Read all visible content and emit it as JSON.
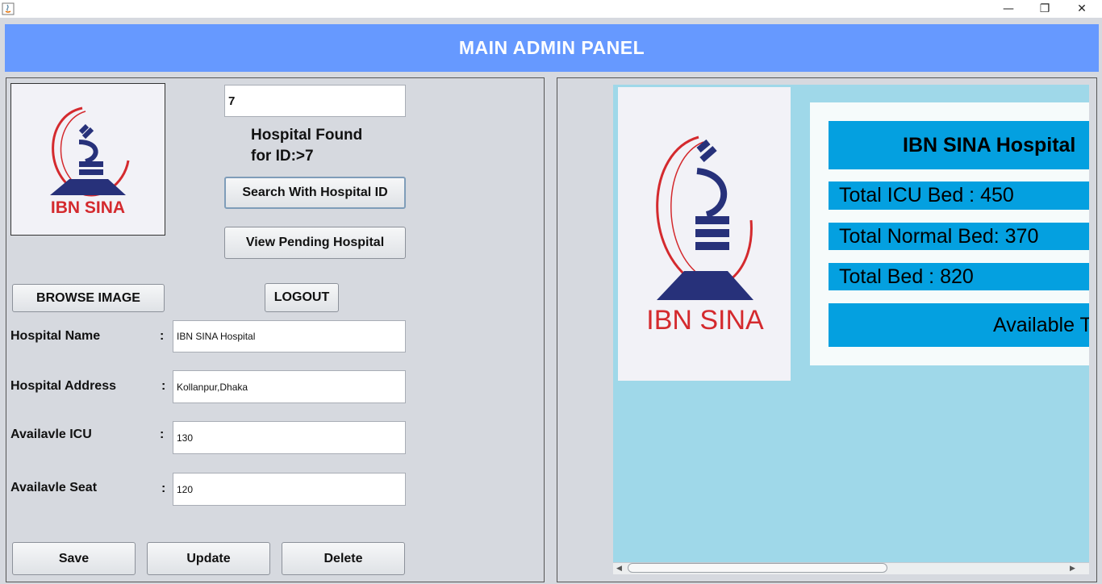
{
  "window": {
    "minimize_glyph": "—",
    "restore_glyph": "❐",
    "close_glyph": "✕"
  },
  "header": {
    "title": "MAIN ADMIN PANEL"
  },
  "search": {
    "id_value": "7",
    "status_line1": "Hospital Found",
    "status_line2": "for ID:>7",
    "search_button": "Search With Hospital ID",
    "pending_button": "View Pending Hospital"
  },
  "actions": {
    "browse_image": "BROWSE IMAGE",
    "logout": "LOGOUT",
    "save": "Save",
    "update": "Update",
    "delete": "Delete"
  },
  "form": {
    "colon": ":",
    "fields": [
      {
        "label": "Hospital Name",
        "value": "IBN SINA Hospital"
      },
      {
        "label": "Hospital Address",
        "value": "Kollanpur,Dhaka"
      },
      {
        "label": "Availavle ICU",
        "value": "130"
      },
      {
        "label": "Availavle Seat",
        "value": "120"
      }
    ]
  },
  "logo": {
    "text": "IBN SINA",
    "brand_red": "#d42a2e",
    "brand_blue": "#27317a"
  },
  "preview": {
    "title": "IBN SINA Hospital",
    "icu": "Total ICU Bed : 450",
    "normal": "Total Normal Bed: 370",
    "total": "Total Bed : 820",
    "available": "Available T"
  },
  "colors": {
    "header": "#6699ff",
    "bar": "#04a0e0",
    "viewport": "#9fd8e9"
  }
}
